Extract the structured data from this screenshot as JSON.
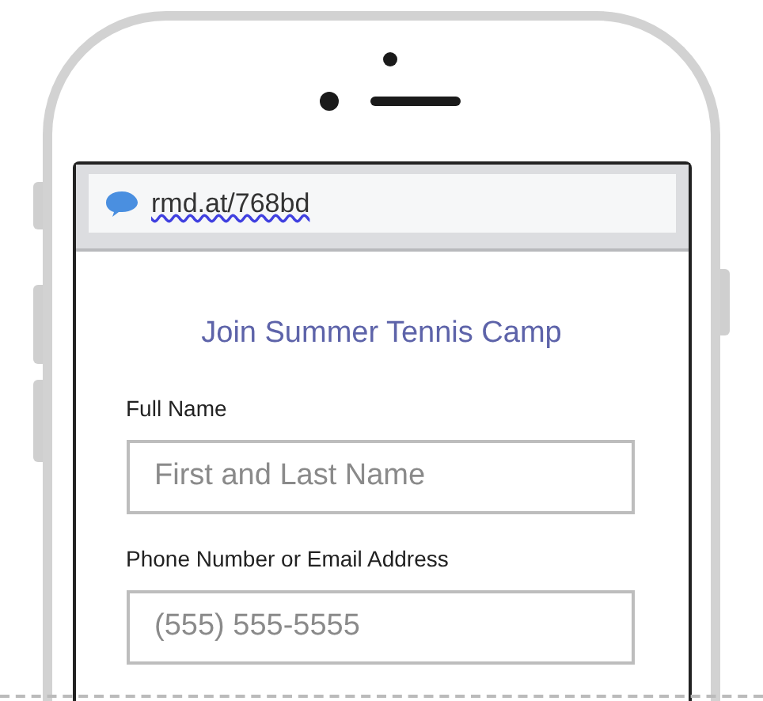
{
  "browser": {
    "url": "rmd.at/768bd"
  },
  "form": {
    "title": "Join Summer Tennis Camp",
    "fields": [
      {
        "label": "Full Name",
        "placeholder": "First and Last Name"
      },
      {
        "label": "Phone Number or Email Address",
        "placeholder": "(555) 555-5555"
      }
    ]
  }
}
